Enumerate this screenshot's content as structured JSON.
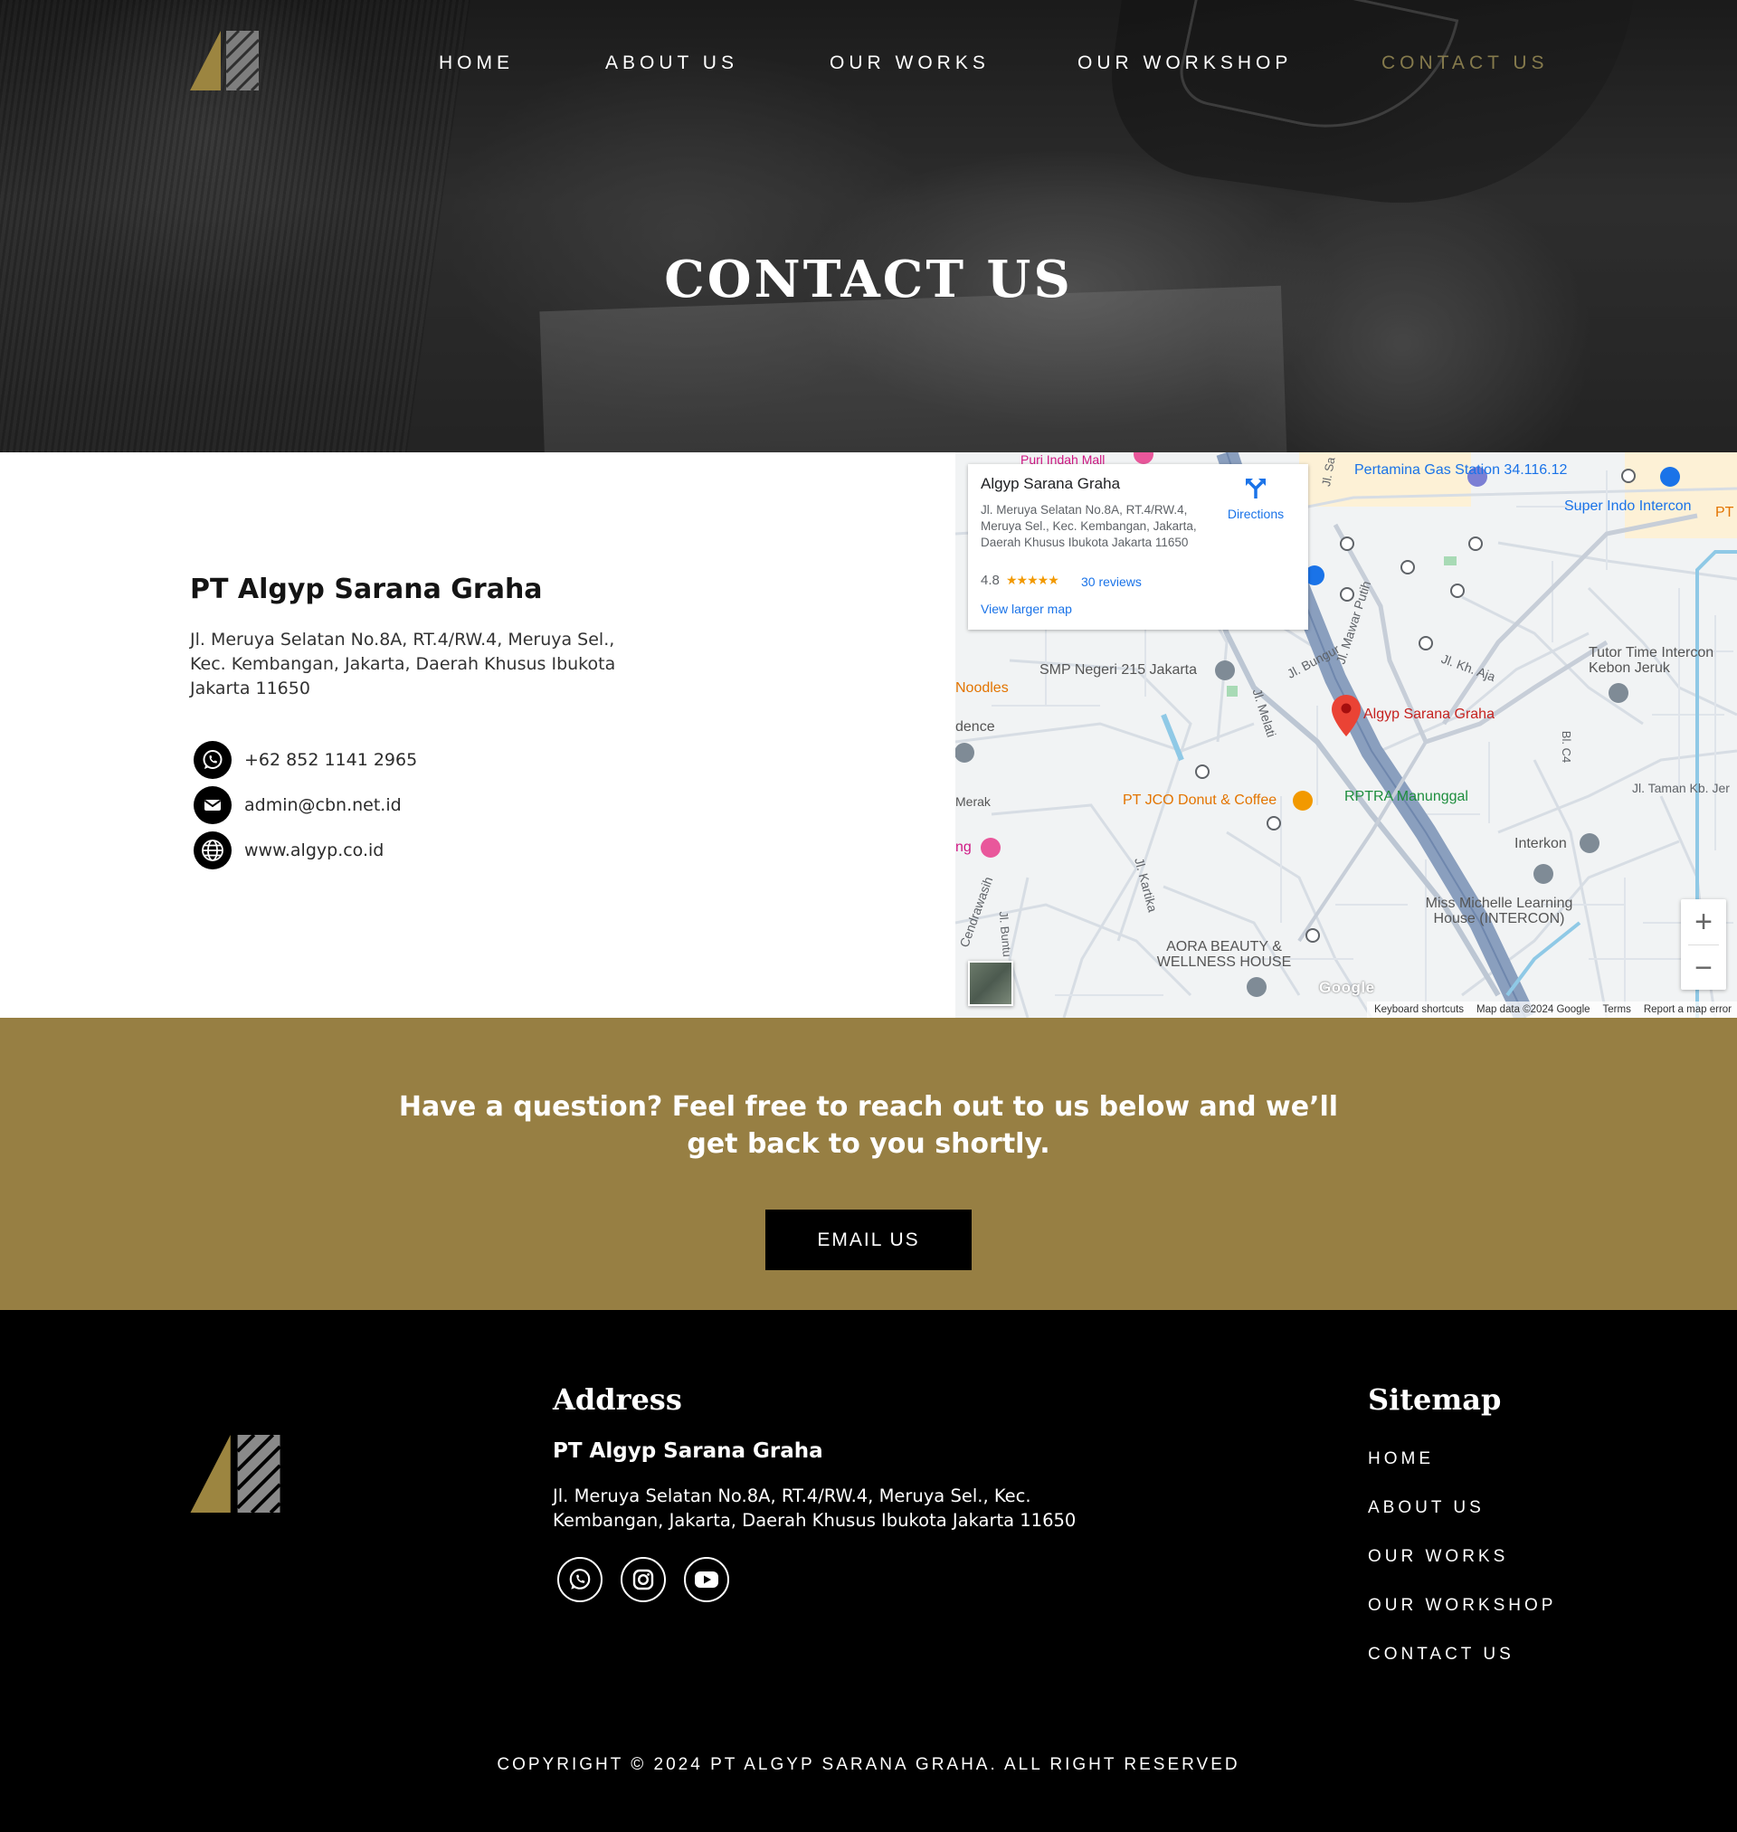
{
  "nav": {
    "items": [
      {
        "label": "HOME",
        "active": false
      },
      {
        "label": "ABOUT US",
        "active": false
      },
      {
        "label": "OUR WORKS",
        "active": false
      },
      {
        "label": "OUR WORKSHOP",
        "active": false
      },
      {
        "label": "CONTACT US",
        "active": true
      }
    ]
  },
  "hero": {
    "title": "CONTACT US"
  },
  "contact": {
    "company_name": "PT Algyp Sarana Graha",
    "address": "Jl. Meruya Selatan No.8A, RT.4/RW.4, Meruya Sel., Kec. Kembangan, Jakarta, Daerah Khusus Ibukota Jakarta 11650",
    "phone": "+62 852 1141 2965",
    "email": "admin@cbn.net.id",
    "website": "www.algyp.co.id"
  },
  "map": {
    "card": {
      "title": "Algyp Sarana Graha",
      "address": "Jl. Meruya Selatan No.8A, RT.4/RW.4, Meruya Sel., Kec. Kembangan, Jakarta, Daerah Khusus Ibukota Jakarta 11650",
      "rating": "4.8",
      "stars": "★★★★★",
      "reviews": "30 reviews",
      "directions": "Directions",
      "larger_map": "View larger map"
    },
    "labels": {
      "pin": "Algyp Sarana Graha",
      "pertamina": "Pertamina Gas Station 34.116.12",
      "superindo": "Super Indo Intercon",
      "smp": "SMP Negeri 215 Jakarta",
      "noodles": "Noodles",
      "dence": "dence",
      "jco": "PT JCO Donut & Coffee",
      "rptra": "RPTRA Manunggal",
      "tutor": "Tutor Time Intercon Kebon Jeruk",
      "interkon": "Interkon",
      "miss": "Miss Michelle Learning House (INTERCON)",
      "aora": "AORA BEAUTY & WELLNESS HOUSE",
      "merak": "Merak",
      "ng": "ng",
      "pt_right": "PT & C",
      "puri": "Puri Indah Mall",
      "jl_mawar": "Jl. Mawar Putih",
      "jl_bungur": "Jl. Bungur",
      "jl_melati": "Jl. Melati",
      "jl_kh": "Jl. Kh. Aja",
      "jl_kartika": "Jl. Kartika",
      "jl_taman": "Jl. Taman Kb. Jer",
      "jl_bl": "Bl. C4",
      "jl_cendrawasih": "Cendrawasih",
      "jl_buntu": "Jl. Buntu",
      "jl_sa": "Jl. Sa"
    },
    "google": "Google",
    "footer": [
      "Keyboard shortcuts",
      "Map data ©2024 Google",
      "Terms",
      "Report a map error"
    ],
    "zoom_in": "+",
    "zoom_out": "−"
  },
  "cta": {
    "text": "Have a question? Feel free to reach out to us below and we’ll get back to you shortly.",
    "button": "EMAIL US"
  },
  "footer": {
    "address_heading": "Address",
    "company": "PT Algyp Sarana Graha",
    "address": "Jl. Meruya Selatan No.8A, RT.4/RW.4, Meruya Sel., Kec. Kembangan, Jakarta, Daerah Khusus Ibukota Jakarta 11650",
    "social": [
      "whatsapp-icon",
      "instagram-icon",
      "youtube-icon"
    ],
    "sitemap_heading": "Sitemap",
    "sitemap": [
      "HOME",
      "ABOUT US",
      "OUR WORKS",
      "OUR WORKSHOP",
      "CONTACT US"
    ],
    "copyright": "COPYRIGHT © 2024 PT ALGYP SARANA GRAHA. ALL RIGHT RESERVED"
  },
  "colors": {
    "gold": "#977f43",
    "nav_active": "#857a4c",
    "black": "#000000"
  }
}
